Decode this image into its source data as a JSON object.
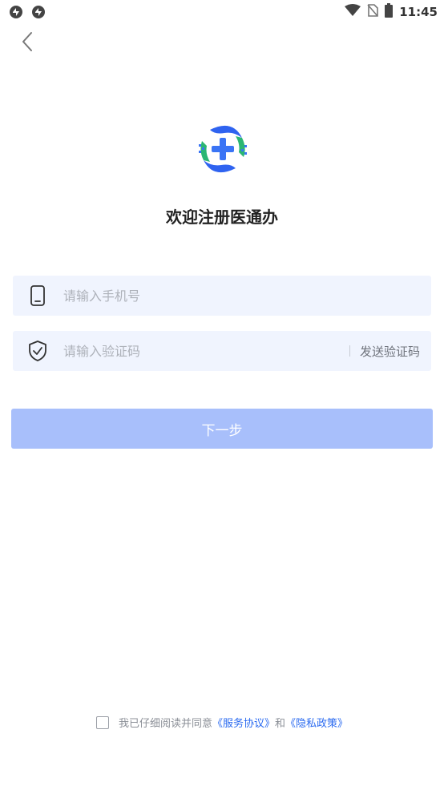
{
  "status_bar": {
    "time": "11:45",
    "left_icons": [
      "sync-icon",
      "sync-icon"
    ],
    "right_icons": [
      "wifi-icon",
      "no-sim-icon",
      "battery-icon"
    ]
  },
  "nav": {
    "back_icon": "chevron-left-icon"
  },
  "page": {
    "title": "欢迎注册医通办"
  },
  "form": {
    "phone_placeholder": "请输入手机号",
    "code_placeholder": "请输入验证码",
    "send_code_label": "发送验证码",
    "next_label": "下一步"
  },
  "agreement": {
    "prefix": "我已仔细阅读并同意",
    "service_link": "《服务协议》",
    "conjunction": "和",
    "privacy_link": "《隐私政策》",
    "checked": false
  },
  "colors": {
    "accent": "#2a6af0",
    "input_bg": "#f0f4fe",
    "button_disabled": "#a8bffb",
    "logo_blue": "#2f63f0",
    "logo_green": "#2bb673"
  }
}
